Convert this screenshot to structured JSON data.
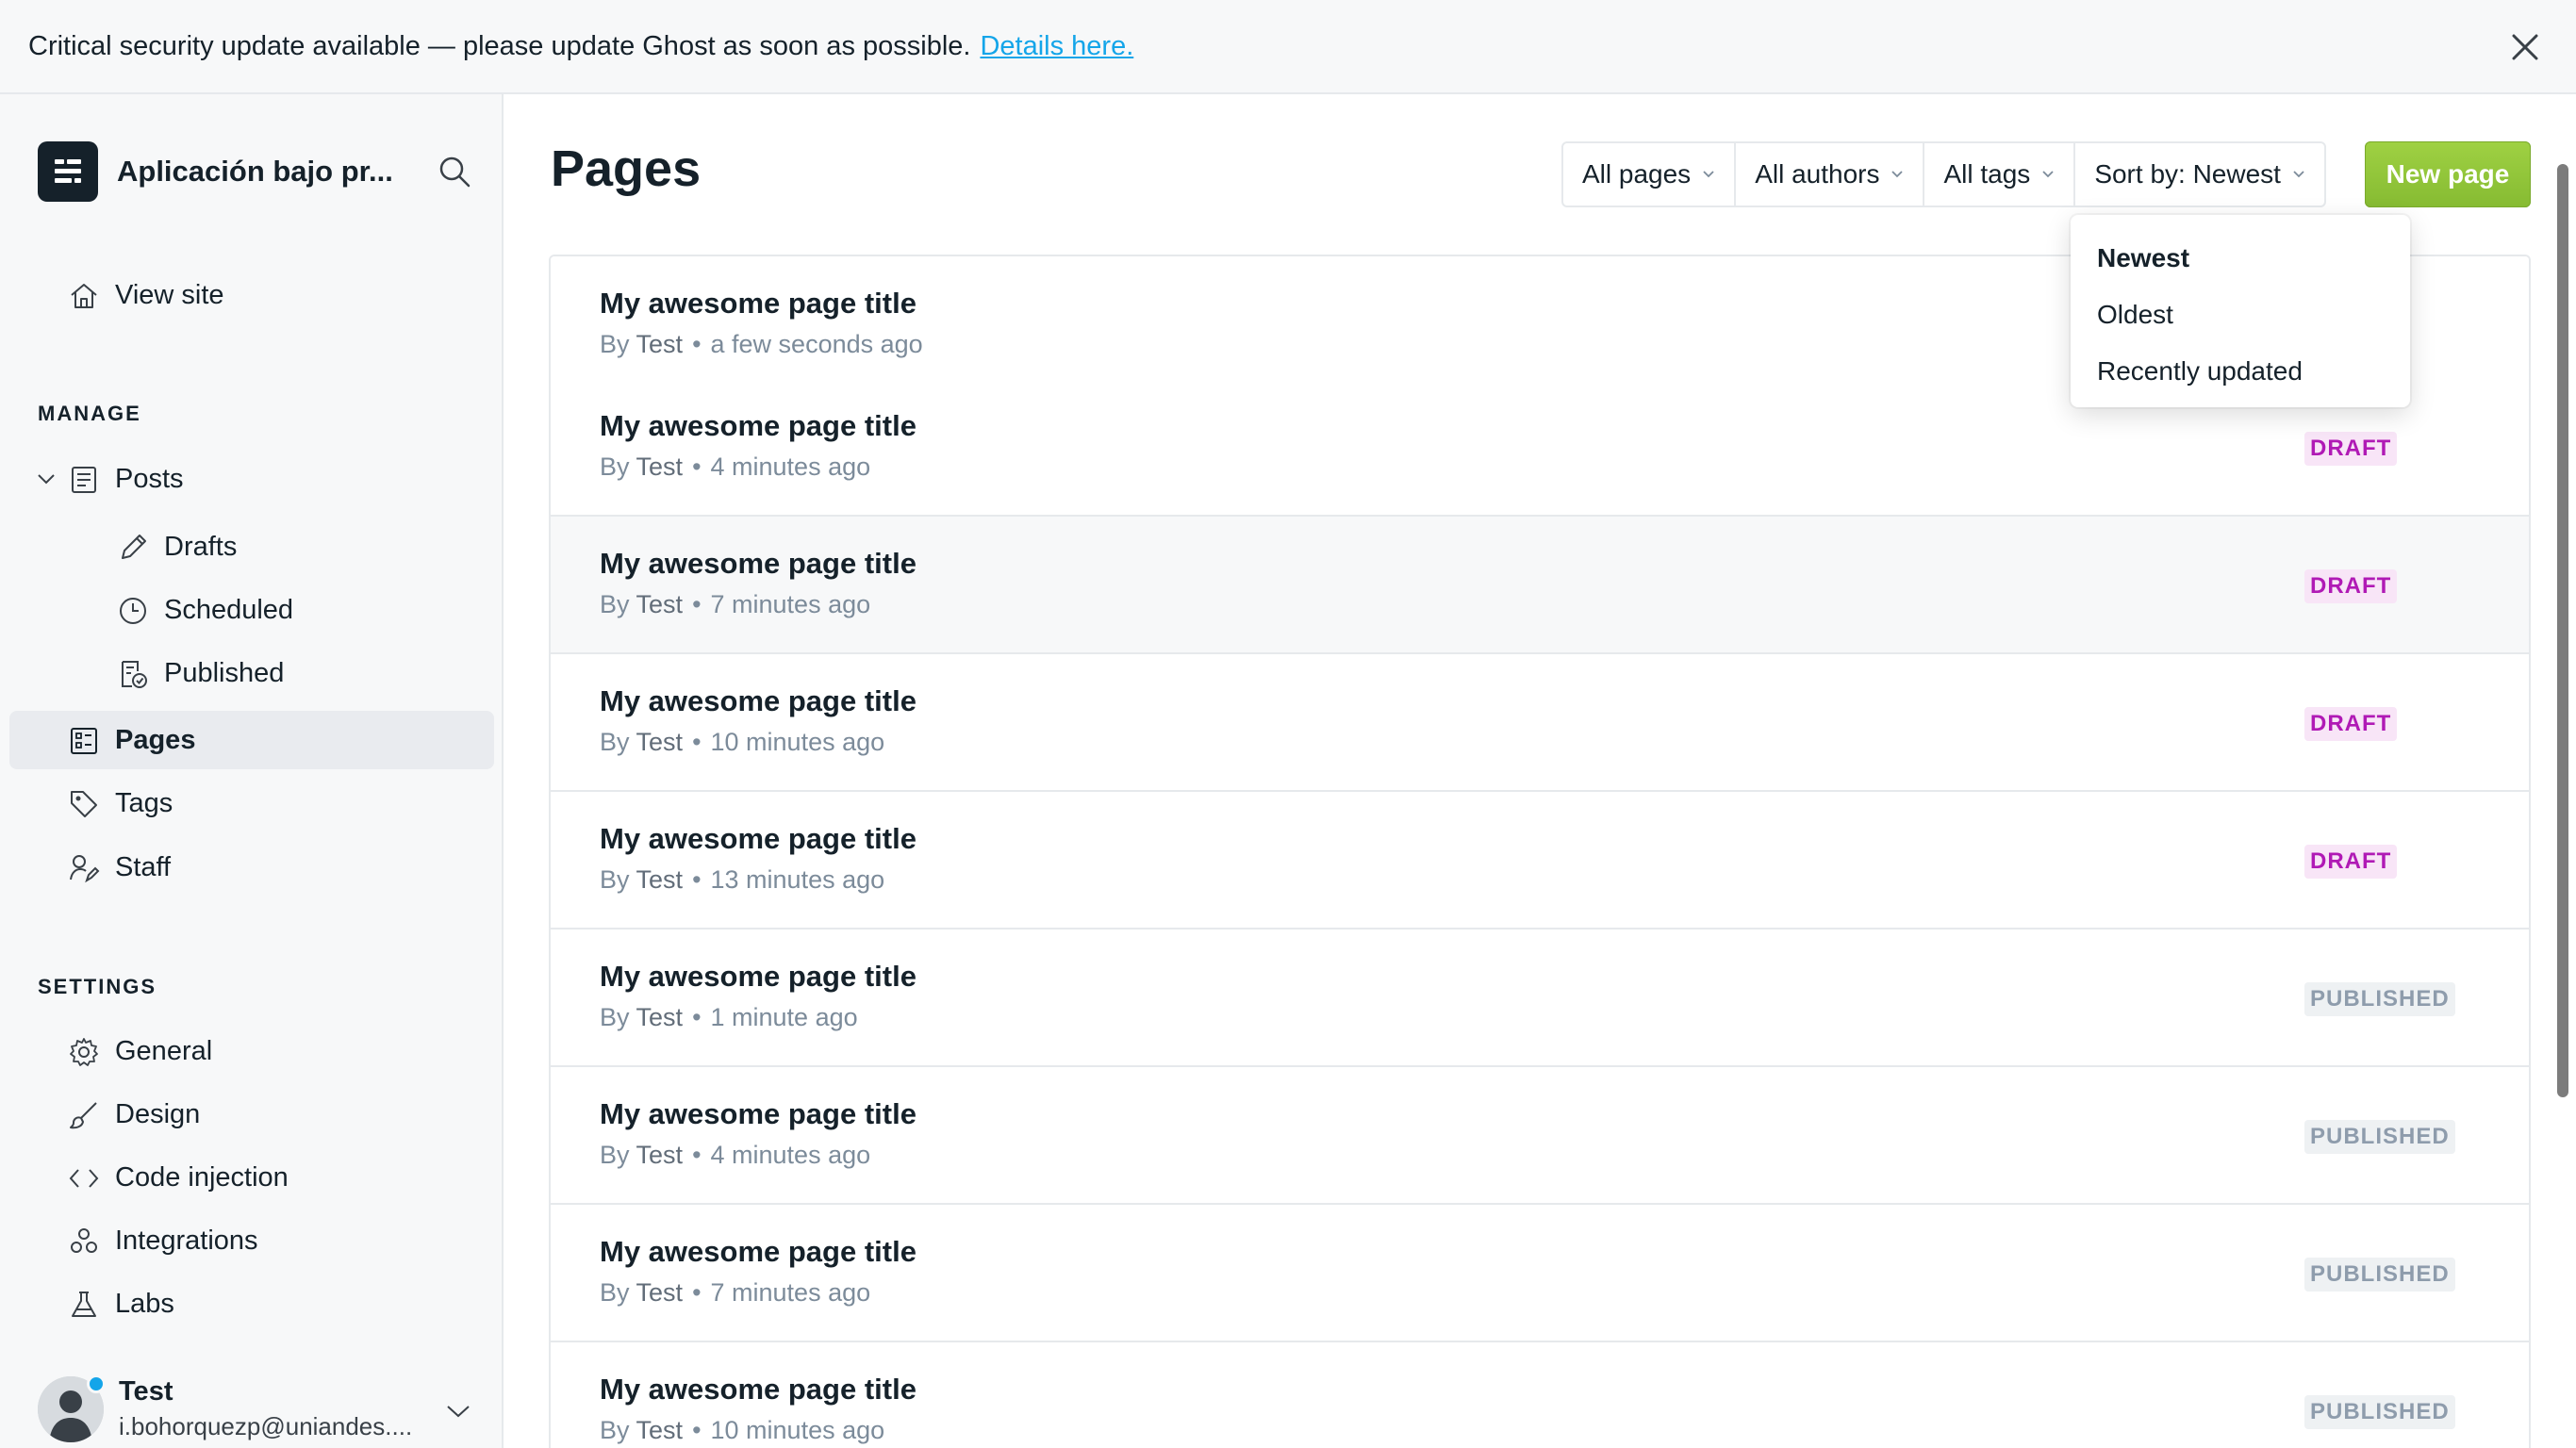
{
  "banner": {
    "message": "Critical security update available — please update Ghost as soon as possible.",
    "link": "Details here."
  },
  "brand": {
    "name": "Aplicación bajo pr..."
  },
  "nav": {
    "view_site": "View site",
    "manage_label": "MANAGE",
    "posts": "Posts",
    "drafts": "Drafts",
    "scheduled": "Scheduled",
    "published": "Published",
    "pages": "Pages",
    "tags": "Tags",
    "staff": "Staff",
    "settings_label": "SETTINGS",
    "general": "General",
    "design": "Design",
    "code_injection": "Code injection",
    "integrations": "Integrations",
    "labs": "Labs"
  },
  "user": {
    "name": "Test",
    "email": "i.bohorquezp@uniandes...."
  },
  "main": {
    "title": "Pages",
    "filters": {
      "type": "All pages",
      "authors": "All authors",
      "tags": "All tags",
      "sort": "Sort by: Newest"
    },
    "new_page": "New page",
    "sort_menu": [
      "Newest",
      "Oldest",
      "Recently updated"
    ],
    "rows": [
      {
        "title": "My awesome page title",
        "by": "By",
        "author": "Test",
        "time": "a few seconds ago",
        "status": ""
      },
      {
        "title": "My awesome page title",
        "by": "By",
        "author": "Test",
        "time": "4 minutes ago",
        "status": "DRAFT"
      },
      {
        "title": "My awesome page title",
        "by": "By",
        "author": "Test",
        "time": "7 minutes ago",
        "status": "DRAFT"
      },
      {
        "title": "My awesome page title",
        "by": "By",
        "author": "Test",
        "time": "10 minutes ago",
        "status": "DRAFT"
      },
      {
        "title": "My awesome page title",
        "by": "By",
        "author": "Test",
        "time": "13 minutes ago",
        "status": "DRAFT"
      },
      {
        "title": "My awesome page title",
        "by": "By",
        "author": "Test",
        "time": "1 minute ago",
        "status": "PUBLISHED"
      },
      {
        "title": "My awesome page title",
        "by": "By",
        "author": "Test",
        "time": "4 minutes ago",
        "status": "PUBLISHED"
      },
      {
        "title": "My awesome page title",
        "by": "By",
        "author": "Test",
        "time": "7 minutes ago",
        "status": "PUBLISHED"
      },
      {
        "title": "My awesome page title",
        "by": "By",
        "author": "Test",
        "time": "10 minutes ago",
        "status": "PUBLISHED"
      }
    ]
  },
  "colors": {
    "accent": "#14a5e9",
    "primary_button": "#8fc43a",
    "draft": "#b01ab5",
    "published": "#8e9cac"
  }
}
